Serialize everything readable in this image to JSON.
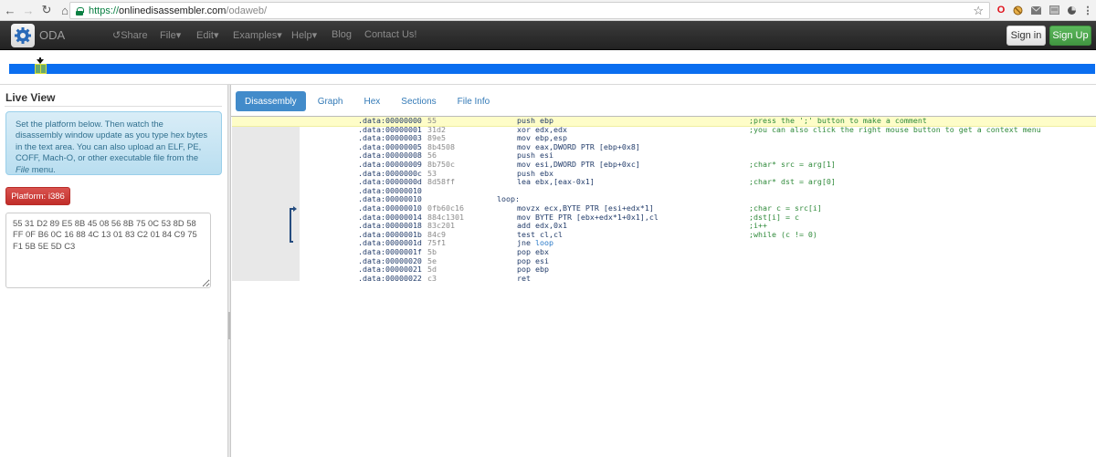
{
  "browser": {
    "url_scheme": "https://",
    "url_host": "onlinedisassembler.com",
    "url_path": "/odaweb/",
    "icons": [
      "back-icon",
      "forward-icon",
      "reload-icon",
      "home-icon",
      "lock-icon",
      "bookmark-star-icon",
      "opera-icon",
      "blocker-icon",
      "mail-icon",
      "cast-icon",
      "clock-icon",
      "menu-icon"
    ]
  },
  "navbar": {
    "brand": "ODA",
    "share": "Share",
    "file": "File",
    "edit": "Edit",
    "examples": "Examples",
    "help": "Help",
    "blog": "Blog",
    "contact": "Contact Us!",
    "sign_in": "Sign in",
    "sign_up": "Sign Up"
  },
  "live_view": {
    "title": "Live View",
    "info_pre": "Set the platform below. Then watch the disassembly window update as you type hex bytes in the text area. You can also upload an ELF, PE, COFF, Mach-O, or other executable file from the ",
    "info_em": "File",
    "info_post": " menu.",
    "platform_label": "Platform: i386",
    "hex_bytes": "55 31 D2 89 E5 8B 45 08 56 8B 75 0C 53 8D 58 FF 0F B6 0C 16 88 4C 13 01 83 C2 01 84 C9 75 F1 5B 5E 5D C3"
  },
  "tabs": [
    {
      "label": "Disassembly",
      "active": true
    },
    {
      "label": "Graph",
      "active": false
    },
    {
      "label": "Hex",
      "active": false
    },
    {
      "label": "Sections",
      "active": false
    },
    {
      "label": "File Info",
      "active": false
    }
  ],
  "disassembly": [
    {
      "addr": ".data:00000000",
      "bytes": "55",
      "label": "",
      "ins": "push ebp",
      "cmt": ";press the ';' button to make a comment",
      "hl": true
    },
    {
      "addr": ".data:00000001",
      "bytes": "31d2",
      "label": "",
      "ins": "xor edx,edx",
      "cmt": ";you can also click the right mouse button to get a context menu"
    },
    {
      "addr": ".data:00000003",
      "bytes": "89e5",
      "label": "",
      "ins": "mov ebp,esp",
      "cmt": ""
    },
    {
      "addr": ".data:00000005",
      "bytes": "8b4508",
      "label": "",
      "ins": "mov eax,DWORD PTR [ebp+0x8]",
      "cmt": ""
    },
    {
      "addr": ".data:00000008",
      "bytes": "56",
      "label": "",
      "ins": "push esi",
      "cmt": ""
    },
    {
      "addr": ".data:00000009",
      "bytes": "8b750c",
      "label": "",
      "ins": "mov esi,DWORD PTR [ebp+0xc]",
      "cmt": ";char* src = arg[1]"
    },
    {
      "addr": ".data:0000000c",
      "bytes": "53",
      "label": "",
      "ins": "push ebx",
      "cmt": ""
    },
    {
      "addr": ".data:0000000d",
      "bytes": "8d58ff",
      "label": "",
      "ins": "lea ebx,[eax-0x1]",
      "cmt": ";char* dst = arg[0]"
    },
    {
      "addr": ".data:00000010",
      "bytes": "",
      "label": "",
      "ins": "",
      "cmt": ""
    },
    {
      "addr": ".data:00000010",
      "bytes": "",
      "label": "loop:",
      "ins": "",
      "cmt": ""
    },
    {
      "addr": ".data:00000010",
      "bytes": "0fb60c16",
      "label": "",
      "ins": "movzx ecx,BYTE PTR [esi+edx*1]",
      "cmt": ";char c = src[i]"
    },
    {
      "addr": ".data:00000014",
      "bytes": "884c1301",
      "label": "",
      "ins": "mov BYTE PTR [ebx+edx*1+0x1],cl",
      "cmt": ";dst[i] = c"
    },
    {
      "addr": ".data:00000018",
      "bytes": "83c201",
      "label": "",
      "ins": "add edx,0x1",
      "cmt": ";i++"
    },
    {
      "addr": ".data:0000001b",
      "bytes": "84c9",
      "label": "",
      "ins": "test cl,cl",
      "cmt": ";while (c != 0)"
    },
    {
      "addr": ".data:0000001d",
      "bytes": "75f1",
      "label": "",
      "ins": "jne ",
      "link": "loop",
      "cmt": ""
    },
    {
      "addr": ".data:0000001f",
      "bytes": "5b",
      "label": "",
      "ins": "pop ebx",
      "cmt": ""
    },
    {
      "addr": ".data:00000020",
      "bytes": "5e",
      "label": "",
      "ins": "pop esi",
      "cmt": ""
    },
    {
      "addr": ".data:00000021",
      "bytes": "5d",
      "label": "",
      "ins": "pop ebp",
      "cmt": ""
    },
    {
      "addr": ".data:00000022",
      "bytes": "c3",
      "label": "",
      "ins": "ret",
      "cmt": ""
    }
  ],
  "colors": {
    "overview_bar": "#0a6ef0",
    "highlight_row": "#fefdc8",
    "comment": "#2f8a3a",
    "tab_active": "#428bca",
    "platform_button": "#d9534f",
    "sign_up": "#5cb85c"
  }
}
